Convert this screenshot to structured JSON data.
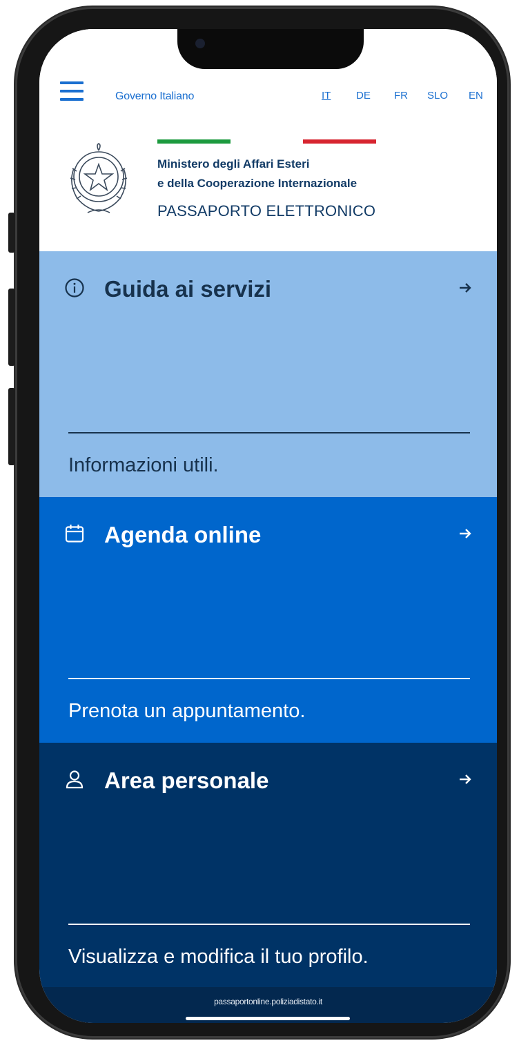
{
  "header": {
    "gov_link": "Governo Italiano",
    "languages": [
      "IT",
      "DE",
      "FR",
      "SLO",
      "EN"
    ],
    "active_language": "IT",
    "ministry_line1": "Ministero degli Affari Esteri",
    "ministry_line2": "e della Cooperazione Internazionale",
    "service_title": "PASSAPORTO ELETTRONICO"
  },
  "cards": [
    {
      "icon": "info-icon",
      "title": "Guida ai servizi",
      "description": "Informazioni utili."
    },
    {
      "icon": "calendar-icon",
      "title": "Agenda online",
      "description": "Prenota un appuntamento."
    },
    {
      "icon": "user-icon",
      "title": "Area personale",
      "description": "Visualizza e modifica il tuo profilo."
    }
  ],
  "footer": {
    "url": "passaportonline.poliziadistato.it"
  },
  "colors": {
    "card_light_blue": "#8dbbe9",
    "card_blue": "#0066cc",
    "card_dark_blue": "#003366",
    "accent_blue": "#1a6fd0",
    "flag_green": "#1c9a3e",
    "flag_red": "#d7242f"
  }
}
